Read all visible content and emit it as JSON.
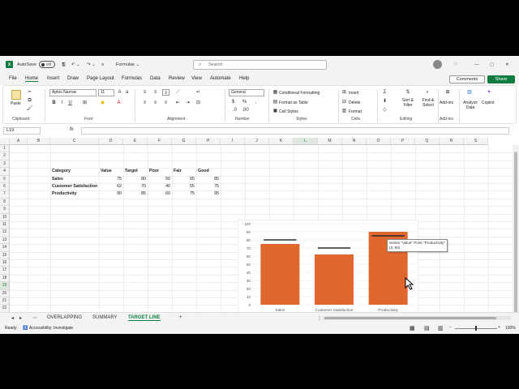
{
  "titlebar": {
    "autosave_label": "AutoSave",
    "autosave_state": "Off",
    "doc_name": "Formulas ⌄",
    "search_placeholder": "Search"
  },
  "menu": [
    "File",
    "Home",
    "Insert",
    "Draw",
    "Page Layout",
    "Formulas",
    "Data",
    "Review",
    "View",
    "Automate",
    "Help"
  ],
  "menu_active": "Home",
  "comments_label": "Comments",
  "share_label": "Share",
  "ribbon": {
    "paste": "Paste",
    "font_name": "Aptos Narrow",
    "font_size": "11",
    "number_format": "General",
    "conditional_formatting": "Conditional Formatting",
    "format_as_table": "Format as Table",
    "cell_styles": "Cell Styles",
    "insert": "Insert",
    "delete": "Delete",
    "format": "Format",
    "sort_filter": "Sort & Filter",
    "find_select": "Find & Select",
    "addins": "Add-ins",
    "analyze_data": "Analyze Data",
    "copilot": "Copilot",
    "groups": [
      "Clipboard",
      "Font",
      "Alignment",
      "Number",
      "Styles",
      "Cells",
      "Editing",
      "Add-ins"
    ]
  },
  "formula_bar": {
    "name_box": "L19",
    "fx": "fx",
    "content": ""
  },
  "columns": [
    "A",
    "B",
    "C",
    "D",
    "E",
    "F",
    "G",
    "H",
    "I",
    "J",
    "K",
    "L",
    "M",
    "N",
    "O",
    "P",
    "Q",
    "R",
    "S"
  ],
  "rows": [
    "1",
    "2",
    "3",
    "4",
    "5",
    "6",
    "7",
    "8",
    "9",
    "10",
    "11",
    "12",
    "13",
    "14",
    "15",
    "16",
    "17",
    "18",
    "19",
    "20",
    "21",
    "22"
  ],
  "table": {
    "headers": [
      "Category",
      "Value",
      "Target",
      "Poor",
      "Fair",
      "Good"
    ],
    "rows": [
      [
        "Sales",
        "75",
        "80",
        "50",
        "65",
        "85"
      ],
      [
        "Customer Satisfaction",
        "62",
        "70",
        "40",
        "55",
        "75"
      ],
      [
        "Productivity",
        "90",
        "85",
        "60",
        "75",
        "95"
      ]
    ]
  },
  "chart_data": {
    "type": "bar",
    "categories": [
      "Sales",
      "Customer Satisfaction",
      "Productivity"
    ],
    "series": [
      {
        "name": "Value",
        "values": [
          75,
          62,
          90
        ]
      },
      {
        "name": "Target",
        "values": [
          80,
          70,
          85
        ]
      }
    ],
    "ylim": [
      0,
      100
    ],
    "yticks": [
      "0",
      "10",
      "20",
      "30",
      "40",
      "50",
      "60",
      "70",
      "80",
      "90",
      "100"
    ],
    "legend": [
      "Target",
      "Value"
    ],
    "legend_position": "bottom",
    "bar_color": "#e2672f",
    "target_color": "#2b2b2b",
    "tooltip_line1": "Series \"Value\" Point \"Productivity\"",
    "tooltip_line2": "(3, 90)"
  },
  "sheets": [
    "OVERLAPPING",
    "SUMMARY",
    "TARGET LINE"
  ],
  "active_sheet": "TARGET LINE",
  "status": {
    "ready": "Ready",
    "accessibility": "Accessibility: Investigate",
    "zoom": "100%"
  }
}
